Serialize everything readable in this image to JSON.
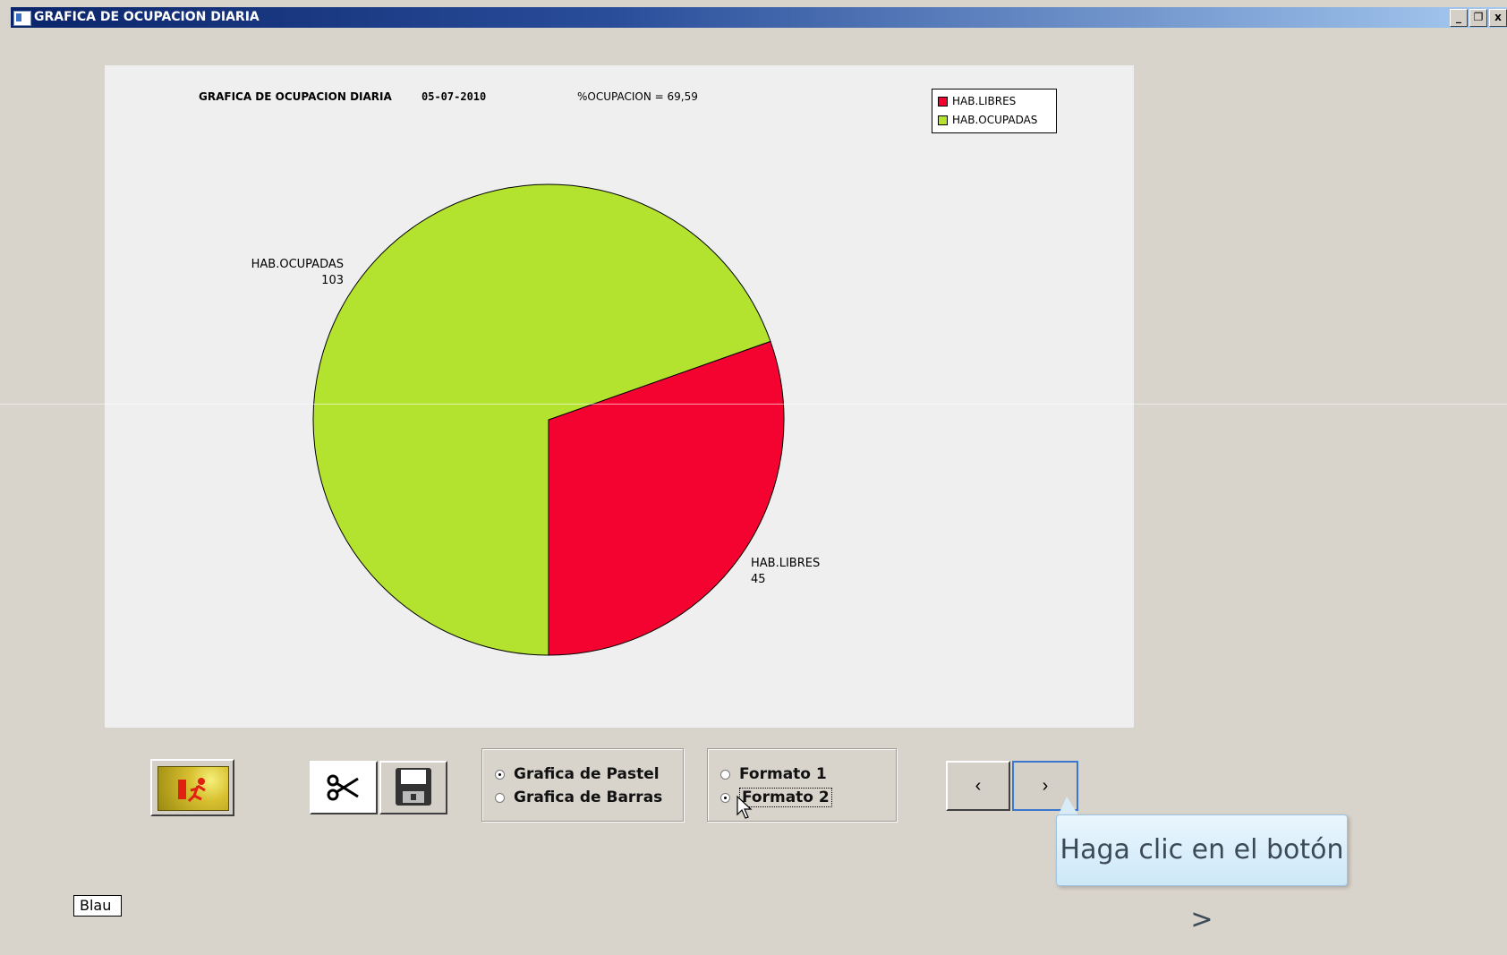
{
  "window": {
    "title": "GRAFICA DE OCUPACION DIARIA",
    "controls": [
      "_",
      "❐",
      "x"
    ]
  },
  "chart_data": {
    "type": "pie",
    "title": "GRAFICA DE OCUPACION DIARIA",
    "date": "05-07-2010",
    "ocupacion_text": "%OCUPACION  =  69,59",
    "categories": [
      "HAB.LIBRES",
      "HAB.OCUPADAS"
    ],
    "values": [
      45,
      103
    ],
    "colors": [
      "#f40331",
      "#b3e32f"
    ],
    "legend_position": "top-right",
    "legend": [
      "HAB.LIBRES",
      "HAB.OCUPADAS"
    ],
    "slice_labels": [
      {
        "name": "HAB.LIBRES",
        "value": "45"
      },
      {
        "name": "HAB.OCUPADAS",
        "value": "103"
      }
    ]
  },
  "controls": {
    "chart_type": {
      "options": [
        "Grafica de Pastel",
        "Grafica de Barras"
      ],
      "selected": "Grafica de Pastel"
    },
    "format": {
      "options": [
        "Formato 1",
        "Formato 2"
      ],
      "selected": "Formato 2"
    },
    "prev_label": "‹",
    "next_label": "›"
  },
  "tooltip": "Haga clic en el botón >",
  "bottom_button": "Blau"
}
